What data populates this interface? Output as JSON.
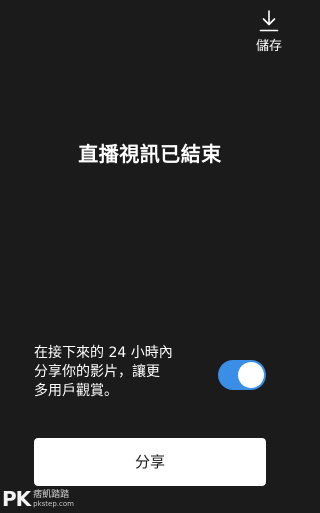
{
  "header": {
    "save_label": "儲存",
    "save_icon": "download-icon"
  },
  "main": {
    "title": "直播視訊已結束"
  },
  "share_option": {
    "description_lines": [
      "在接下來的 24 小時內",
      "分享你的影片，讓更",
      "多用戶觀賞。"
    ],
    "toggle_on": true,
    "toggle_color": "#3a8ee6"
  },
  "share_button": {
    "label": "分享"
  },
  "watermark": {
    "logo": "PK",
    "name": "痞凱踏踏",
    "url": "pkstep.com"
  }
}
